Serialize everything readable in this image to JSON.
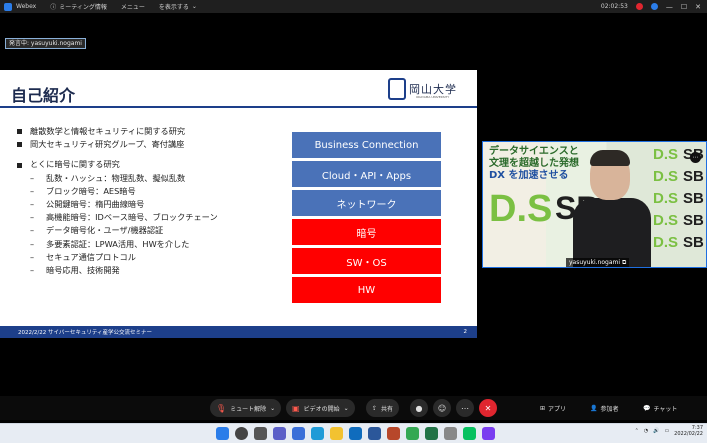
{
  "titlebar": {
    "app_name": "Webex",
    "meeting_label": "ミーティング情報",
    "menu_label": "メニュー",
    "view_label": "を表示する",
    "time": "02:02:53"
  },
  "speaker_tag": "発言中: yasuyuki.nogami",
  "slide": {
    "title": "自己紹介",
    "logo_text": "岡山大学",
    "logo_sub": "OKAYAMA UNIVERSITY",
    "bullets_top": [
      "離散数学と情報セキュリティに関する研究",
      "岡大セキュリティ研究グループ、寄付講座"
    ],
    "bullet_focus": "とくに暗号に関する研究",
    "sub_bullets": [
      "乱数・ハッシュ：物理乱数、擬似乱数",
      "ブロック暗号：AES暗号",
      "公開鍵暗号：楕円曲線暗号",
      "高機能暗号：IDベース暗号、ブロックチェーン",
      "データ暗号化・ユーザ/機器認証",
      "多要素認証：LPWA活用、HWを介した",
      "セキュア通信プロトコル",
      "暗号応用、技術開発"
    ],
    "stack_boxes": [
      {
        "label": "Business Connection",
        "color": "blue"
      },
      {
        "label": "Cloud・API・Apps",
        "color": "blue"
      },
      {
        "label": "ネットワーク",
        "color": "blue"
      },
      {
        "label": "暗号",
        "color": "red"
      },
      {
        "label": "SW・OS",
        "color": "red"
      },
      {
        "label": "HW",
        "color": "red"
      }
    ],
    "footer": "2022/2/22 サイバーセキュリティ産学公交流セミナー",
    "page_number": "2"
  },
  "video": {
    "participant_name": "yasuyuki.nogami",
    "banner_lines": [
      "データサイエンスと",
      "文理を超越した発想",
      "DX を加速させる"
    ],
    "ds_text": "D.S",
    "sb_text": "SB"
  },
  "controls": {
    "mute_label": "ミュート解除",
    "video_label": "ビデオの開始",
    "share_label": "共有",
    "apps_label": "アプリ",
    "participants_label": "参加者",
    "chat_label": "チャット"
  },
  "taskbar": {
    "time": "7:37",
    "date": "2022/02/22"
  }
}
